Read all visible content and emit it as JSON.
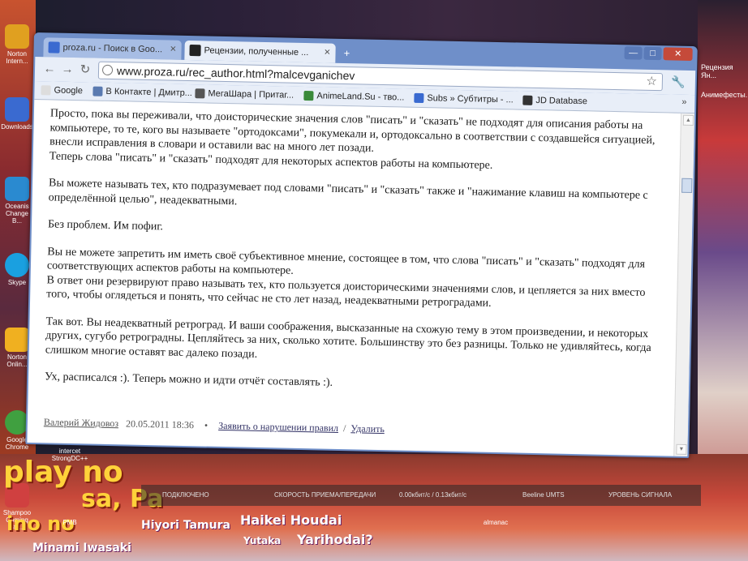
{
  "desktop": {
    "left_icons": [
      {
        "label": "Norton Intern...",
        "color": "#e0a020"
      },
      {
        "label": "Downloads",
        "color": "#3a6ad0"
      },
      {
        "label": "Oceanis Change B...",
        "color": "#2a8ad0"
      },
      {
        "label": "Skype",
        "color": "#1aa0e0"
      },
      {
        "label": "Norton Onlin...",
        "color": "#f0b020"
      },
      {
        "label": "Google Chrome",
        "color": "#40a040"
      },
      {
        "label": "Shampoo Coming Sto...",
        "color": "#d04040"
      }
    ],
    "bottom_icons": [
      {
        "label": "intercet StrongDC++"
      },
      {
        "label": "PMB"
      },
      {
        "label": "almanac"
      }
    ],
    "right_labels": [
      "Рецензия Ян...",
      "Анимефесты..."
    ],
    "banner_texts": [
      "play no",
      "sa, Pa",
      "Haikei Houdai",
      "Hiyori Tamura",
      "Yutaka",
      "Yarihodai?",
      "ino no",
      "Minami Iwasaki"
    ],
    "netbar": {
      "status": "ПОДКЛЮЧЕНО",
      "speed_label": "СКОРОСТЬ ПРИЕМА/ПЕРЕДАЧИ",
      "speed_value": "0.00кбит/с / 0.13кбит/с",
      "operator": "Beeline UMTS",
      "signal_label": "УРОВЕНЬ СИГНАЛА"
    }
  },
  "browser": {
    "tabs": [
      {
        "title": "proza.ru - Поиск в Goo...",
        "active": false,
        "favicon_color": "#3a6ad0"
      },
      {
        "title": "Рецензии, полученные ...",
        "active": true,
        "favicon_color": "#222222"
      }
    ],
    "new_tab": "+",
    "window_buttons": {
      "minimize": "—",
      "maximize": "□",
      "close": "✕"
    },
    "url": "www.proza.ru/rec_author.html?malcevganichev",
    "bookmarks": [
      {
        "label": "Google",
        "color": "#dddddd"
      },
      {
        "label": "В Контакте | Дмитр...",
        "color": "#5a7ab0"
      },
      {
        "label": "МегаШара | Притаг...",
        "color": "#555555"
      },
      {
        "label": "AnimeLand.Su - тво...",
        "color": "#3a8a3a"
      },
      {
        "label": "Subs » Субтитры - ...",
        "color": "#3a6ad0"
      },
      {
        "label": "JD Database",
        "color": "#333333"
      }
    ],
    "bookmarks_more": "»",
    "paragraphs": [
      "Просто, пока вы переживали, что доисторические значения слов \"писать\" и \"сказать\" не подходят для описания работы на компьютере, то те, кого вы называете \"ортодоксами\", покумекали и, ортодоксально в соответствии с создавшейся ситуацией, внесли исправления в словари и оставили вас на много лет позади.",
      "Теперь слова \"писать\" и \"сказать\" подходят для некоторых аспектов работы на компьютере.",
      "Вы можете называть тех, кто подразумевает под словами \"писать\" и \"сказать\" также и \"нажимание клавиш на компьютере с определённой целью\", неадекватными.",
      "Без проблем. Им пофиг.",
      "Вы не можете запретить им иметь своё субъективное мнение, состоящее в том, что слова \"писать\" и \"сказать\" подходят для соответствующих аспектов работы на компьютере.",
      "В ответ они резервируют право называть тех, кто пользуется доисторическими значениями слов, и цепляется за них вместо того, чтобы оглядеться и понять, что сейчас не сто лет назад, неадекватными ретроградами.",
      "Так вот. Вы неадекватный ретроград. И ваши соображения, высказанные на схожую тему в этом произведении, и некоторых других, сугубо ретроградны. Цепляйтесь за них, сколько хотите. Большинству это без разницы. Только не удивляйтесь, когда слишком многие оставят вас далеко позади.",
      "Ух, расписался :). Теперь можно и идти отчёт составлять :)."
    ],
    "signature": {
      "author": "Валерий Жидовоз",
      "date": "20.05.2011 18:36",
      "bullet": "•",
      "report_link": "Заявить о нарушении правил",
      "separator": "/",
      "delete_link": "Удалить"
    }
  }
}
